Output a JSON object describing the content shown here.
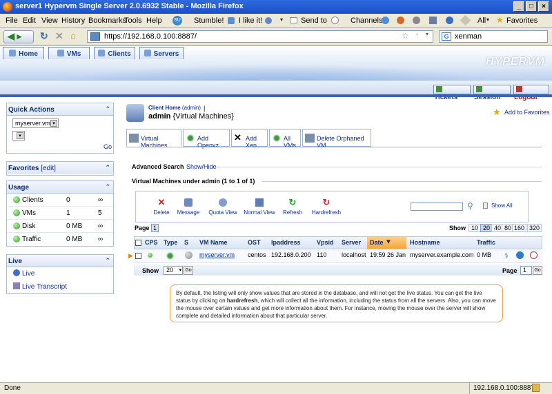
{
  "window": {
    "title": "server1 Hypervm Single Server 2.0.6932 Stable - Mozilla Firefox",
    "min": "_",
    "max": "□",
    "close": "×"
  },
  "menu": [
    "File",
    "Edit",
    "View",
    "History",
    "Bookmarks",
    "Tools",
    "Help"
  ],
  "toolbar": {
    "stumble": "Stumble!",
    "ilike": "I like it!",
    "sendto": "Send to",
    "channels": "Channels:",
    "all": "All",
    "favorites": "Favorites"
  },
  "nav": {
    "url": "https://192.168.0.100:8887/",
    "search": "xenman"
  },
  "logo": "HYPERVM",
  "top_tabs": [
    "Home",
    "VMs",
    "Clients",
    "Servers"
  ],
  "right_tabs": [
    "Tickets",
    "Session",
    "Logout"
  ],
  "sidebar": {
    "quick_actions": {
      "title": "Quick Actions",
      "select_value": "myserver.vm",
      "go": "Go"
    },
    "favorites": {
      "title": "Favorites",
      "edit": "[edit]"
    },
    "usage": {
      "title": "Usage",
      "rows": [
        {
          "label": "Clients",
          "value": "0",
          "max": "∞"
        },
        {
          "label": "VMs",
          "value": "1",
          "max": "5"
        },
        {
          "label": "Disk",
          "value": "0 MB",
          "max": "∞"
        },
        {
          "label": "Traffic",
          "value": "0 MB",
          "max": "∞"
        }
      ]
    },
    "live": {
      "title": "Live",
      "items": [
        "Live",
        "Live Transcript"
      ]
    }
  },
  "header": {
    "client_home": "Client Home",
    "client_home_user": "(admin)",
    "separator": "|",
    "user": "admin",
    "section": "{Virtual Machines}",
    "add_favorites": "Add to Favorites"
  },
  "tabs": [
    "Virtual Machines",
    "Add Openvz",
    "Add Xen",
    "All VMs",
    "Delete Orphaned VM"
  ],
  "advanced_search": {
    "label": "Advanced Search",
    "link": "Show/Hide"
  },
  "list_title": "Virtual Machines under admin (1 to 1 of 1)",
  "actions": [
    "Delete",
    "Message",
    "Quota View",
    "Normal View",
    "Refresh",
    "Hardrefresh"
  ],
  "show_all": "Show All",
  "paging": {
    "page_label": "Page",
    "current_page": "1",
    "show_label": "Show",
    "sizes": [
      "10",
      "20",
      "40",
      "80",
      "160",
      "320"
    ],
    "selected_size": "20",
    "go": "Go"
  },
  "table": {
    "columns": [
      "CPS",
      "Type",
      "S",
      "VM Name",
      "OST",
      "Ipaddress",
      "Vpsid",
      "Server",
      "Date",
      "Hostname",
      "Traffic"
    ],
    "rows": [
      {
        "vm_name": "myserver.vm",
        "ost": "centos",
        "ip": "192.168.0.200",
        "vpsid": "110",
        "server": "localhost",
        "date": "19:59 26 Jan",
        "hostname": "myserver.example.com",
        "traffic": "0 MB"
      }
    ]
  },
  "info_text_parts": [
    "By default, the listing will only show values that are stored in the database, and will not get the live status. You can get the live status by clicking on ",
    "hardrefresh",
    ", which will collect all the information, including the status from all the servers. Also, you can move the mouse over certain values and get more information about them. For instance, moving the mouse over the server will show complete and detailed information about that particular server."
  ],
  "status": {
    "left": "Done",
    "right": "192.168.0.100:8887"
  }
}
